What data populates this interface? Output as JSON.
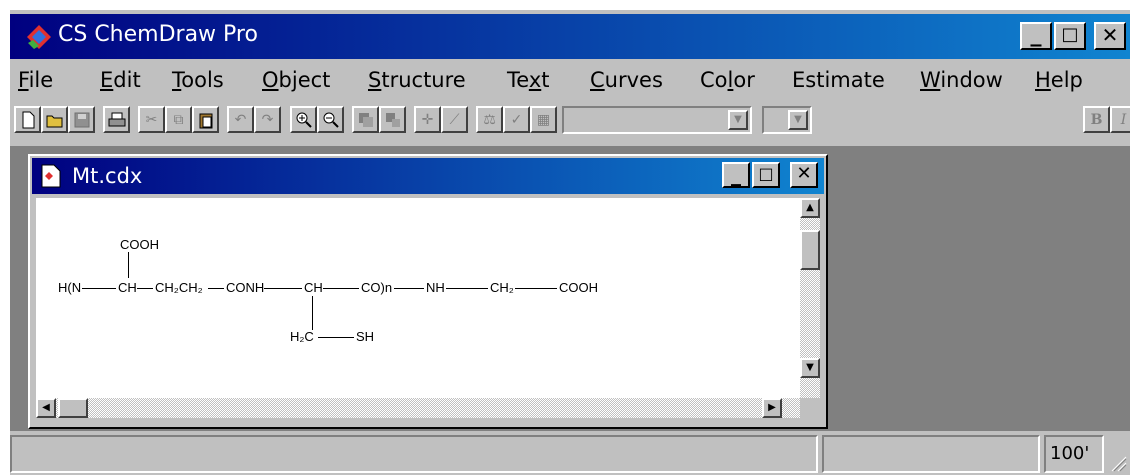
{
  "app": {
    "title": "CS ChemDraw Pro",
    "window_buttons": {
      "minimize": "_",
      "maximize": "□",
      "close": "✕"
    }
  },
  "menu": [
    "File",
    "Edit",
    "Tools",
    "Object",
    "Structure",
    "Text",
    "Curves",
    "Color",
    "Estimate",
    "Window",
    "Help"
  ],
  "toolbar": {
    "buttons": [
      "new",
      "open",
      "save",
      "print",
      "cut",
      "copy",
      "paste",
      "undo",
      "redo",
      "zoom-in",
      "zoom-out",
      "group",
      "ungroup",
      "attach",
      "bond",
      "analyze",
      "check",
      "template"
    ],
    "font_bold": "B",
    "font_italic": "I"
  },
  "document": {
    "title": "Mt.cdx",
    "structure": {
      "row_left": "H(N",
      "ch1": "CH",
      "ch2ch2": "CH₂CH₂",
      "conh": "CONH",
      "ch2": "CH",
      "co_n": "CO)n",
      "nh": "NH",
      "ch2_glycine": "CH₂",
      "cooh_end": "COOH",
      "cooh_top": "COOH",
      "h2c": "H₂C",
      "sh": "SH"
    }
  },
  "status": {
    "zoom": "100'"
  }
}
